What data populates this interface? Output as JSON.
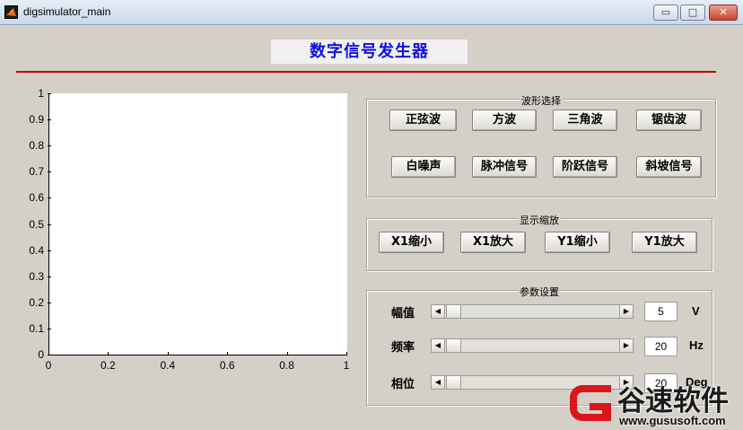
{
  "window": {
    "title": "digsimulator_main",
    "controls": {
      "minimize": "▭",
      "maximize": "□",
      "close": "✕"
    }
  },
  "heading": "数字信号发生器",
  "colors": {
    "heading_text": "#1010e0",
    "rule": "#c00000",
    "panel_bg": "#d4d0c8",
    "plot_bg": "#ffffff"
  },
  "axes": {
    "y_ticks": [
      "0",
      "0.1",
      "0.2",
      "0.3",
      "0.4",
      "0.5",
      "0.6",
      "0.7",
      "0.8",
      "0.9",
      "1"
    ],
    "x_ticks": [
      "0",
      "0.2",
      "0.4",
      "0.6",
      "0.8",
      "1"
    ]
  },
  "waveform_panel": {
    "title": "波形选择",
    "buttons": [
      "正弦波",
      "方波",
      "三角波",
      "锯齿波",
      "白噪声",
      "脉冲信号",
      "阶跃信号",
      "斜坡信号"
    ]
  },
  "zoom_panel": {
    "title": "显示缩放",
    "buttons": [
      "X1缩小",
      "X1放大",
      "Y1缩小",
      "Y1放大"
    ]
  },
  "params_panel": {
    "title": "参数设置",
    "rows": [
      {
        "label": "幅值",
        "value": "5",
        "unit": "V"
      },
      {
        "label": "频率",
        "value": "20",
        "unit": "Hz"
      },
      {
        "label": "相位",
        "value": "20",
        "unit": "Deg"
      }
    ]
  },
  "watermark": {
    "text": "谷速软件",
    "url": "www.gususoft.com"
  }
}
